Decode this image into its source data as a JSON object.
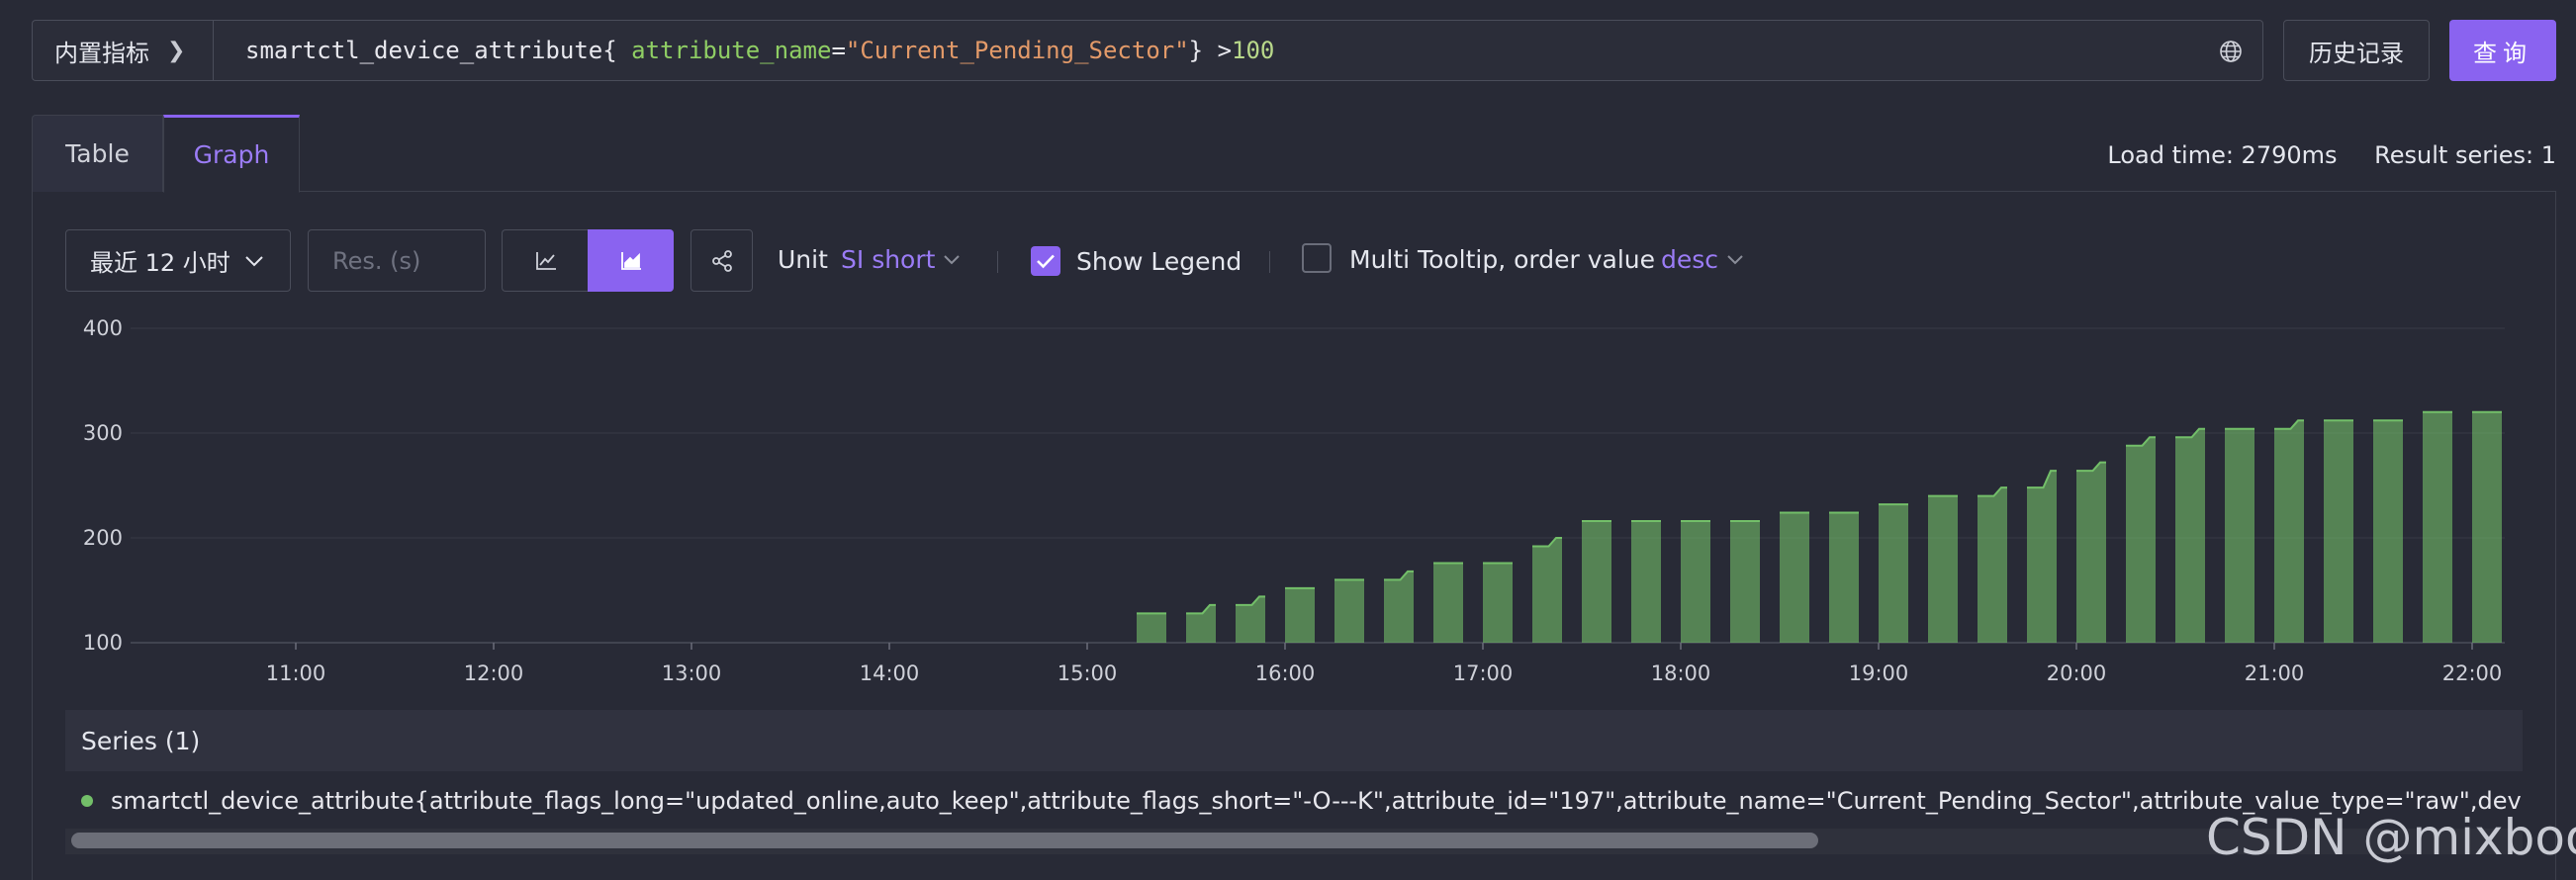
{
  "query_bar": {
    "prefix_label": "内置指标",
    "query_metric": "smartctl_device_attribute{ ",
    "query_label_key": "attribute_name",
    "query_eq": "=",
    "query_label_value": "\"Current_Pending_Sector\"",
    "query_close": "} >",
    "query_threshold": "100",
    "history_label": "历史记录",
    "query_label": "查询"
  },
  "tabs": [
    {
      "label": "Table",
      "active": false
    },
    {
      "label": "Graph",
      "active": true
    }
  ],
  "stats": {
    "load_time": "Load time: 2790ms",
    "result_series": "Result series: 1"
  },
  "toolbar": {
    "time_range": "最近 12 小时",
    "resolution_placeholder": "Res. (s)",
    "unit_label": "Unit",
    "unit_value": "SI short",
    "show_legend_label": "Show Legend",
    "show_legend_checked": true,
    "multi_tooltip_label": "Multi Tooltip, order value",
    "multi_tooltip_checked": false,
    "order_value": "desc",
    "accent_color": "#8a63f0"
  },
  "chart_data": {
    "type": "area",
    "x_ticks": [
      "11:00",
      "12:00",
      "13:00",
      "14:00",
      "15:00",
      "16:00",
      "17:00",
      "18:00",
      "19:00",
      "20:00",
      "21:00",
      "22:00"
    ],
    "y_ticks": [
      100,
      200,
      300,
      400
    ],
    "ylim": [
      100,
      400
    ],
    "series_color": "#73bf69",
    "step_minutes": 15,
    "series": [
      {
        "segments": [
          {
            "start": "15:15",
            "values": [
              128
            ]
          },
          {
            "start": "15:30",
            "values": [
              128,
              136
            ]
          },
          {
            "start": "15:45",
            "values": [
              136,
              144
            ]
          },
          {
            "start": "16:00",
            "values": [
              152
            ]
          },
          {
            "start": "16:15",
            "values": [
              160
            ]
          },
          {
            "start": "16:30",
            "values": [
              160,
              168
            ]
          },
          {
            "start": "16:45",
            "values": [
              176
            ]
          },
          {
            "start": "17:00",
            "values": [
              176
            ]
          },
          {
            "start": "17:15",
            "values": [
              192,
              200
            ]
          },
          {
            "start": "17:30",
            "values": [
              216
            ]
          },
          {
            "start": "17:45",
            "values": [
              216
            ]
          },
          {
            "start": "18:00",
            "values": [
              216
            ]
          },
          {
            "start": "18:15",
            "values": [
              216
            ]
          },
          {
            "start": "18:30",
            "values": [
              224
            ]
          },
          {
            "start": "18:45",
            "values": [
              224
            ]
          },
          {
            "start": "19:00",
            "values": [
              232
            ]
          },
          {
            "start": "19:15",
            "values": [
              240
            ]
          },
          {
            "start": "19:30",
            "values": [
              240,
              248
            ]
          },
          {
            "start": "19:45",
            "values": [
              248,
              264
            ]
          },
          {
            "start": "20:00",
            "values": [
              264,
              272
            ]
          },
          {
            "start": "20:15",
            "values": [
              288,
              296
            ]
          },
          {
            "start": "20:30",
            "values": [
              296,
              304
            ]
          },
          {
            "start": "20:45",
            "values": [
              304
            ]
          },
          {
            "start": "21:00",
            "values": [
              304,
              312
            ]
          },
          {
            "start": "21:15",
            "values": [
              312
            ]
          },
          {
            "start": "21:30",
            "values": [
              312
            ]
          },
          {
            "start": "21:45",
            "values": [
              320
            ]
          },
          {
            "start": "22:00",
            "values": [
              320
            ]
          }
        ]
      }
    ]
  },
  "series_panel": {
    "header": "Series (1)",
    "series_label": "smartctl_device_attribute{attribute_flags_long=\"updated_online,auto_keep\",attribute_flags_short=\"-O---K\",attribute_id=\"197\",attribute_name=\"Current_Pending_Sector\",attribute_value_type=\"raw\",device=\"/dev/sdb\"}"
  },
  "watermark": "CSDN @mixboot"
}
